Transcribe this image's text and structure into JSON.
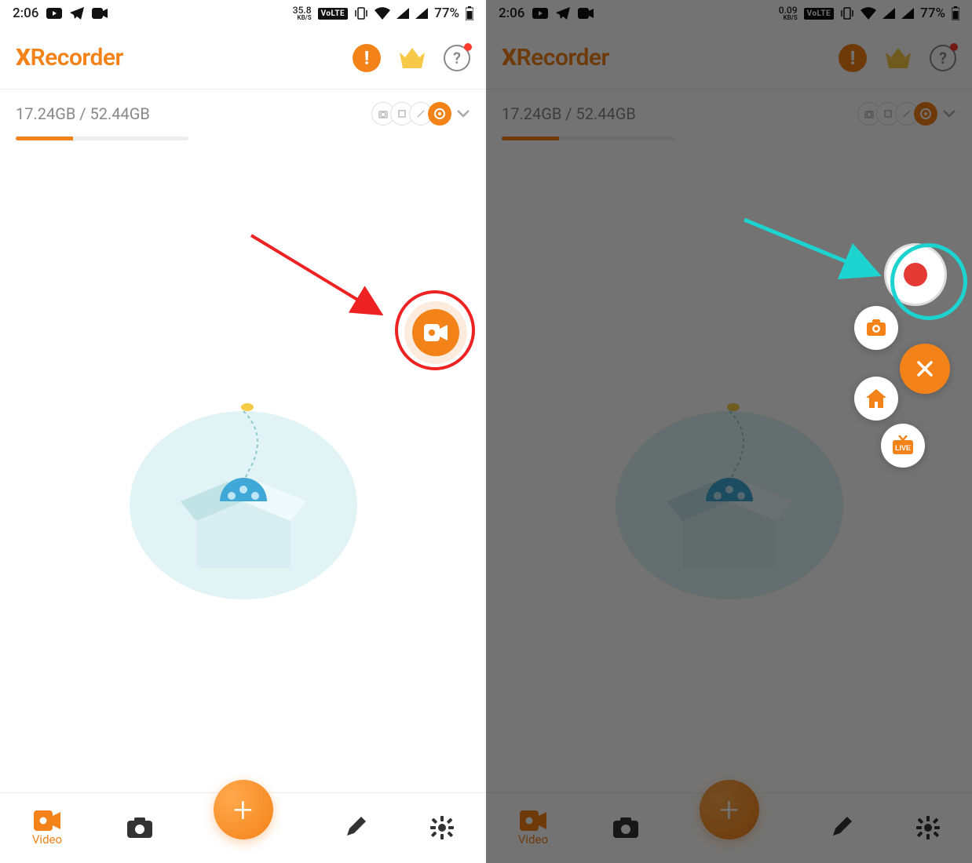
{
  "status": {
    "time": "2:06",
    "kbs_left": "35.8",
    "kbs_right": "0.09",
    "kbs_unit": "KB/S",
    "volte": "VoLTE",
    "battery": "77%"
  },
  "header": {
    "title_x": "X",
    "title_rest": "Recorder"
  },
  "storage": {
    "text": "17.24GB / 52.44GB",
    "fill_percent": 33
  },
  "nav": {
    "video": "Video"
  },
  "overlay": {
    "live": "LIVE"
  }
}
